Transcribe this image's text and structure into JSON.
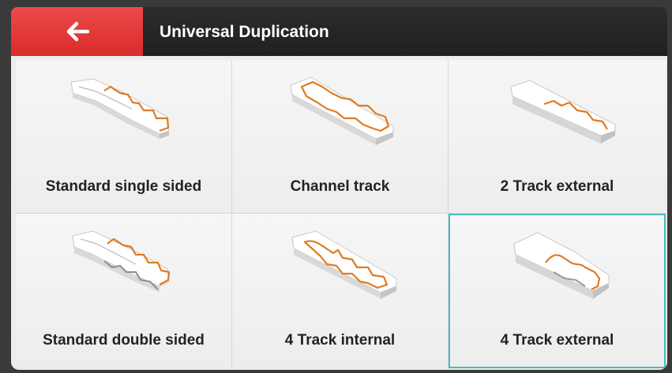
{
  "header": {
    "title": "Universal Duplication",
    "back_icon": "arrow-left-icon",
    "back_color": "#e53a3a"
  },
  "options": [
    {
      "label": "Standard single sided",
      "icon": "key-standard-single-sided-icon"
    },
    {
      "label": "Channel track",
      "icon": "key-channel-track-icon"
    },
    {
      "label": "2 Track external",
      "icon": "key-2-track-external-icon"
    },
    {
      "label": "Standard double sided",
      "icon": "key-standard-double-sided-icon"
    },
    {
      "label": "4 Track internal",
      "icon": "key-4-track-internal-icon"
    },
    {
      "label": "4 Track external",
      "icon": "key-4-track-external-icon"
    }
  ],
  "selected_option": "4 Track external",
  "colors": {
    "accent": "#4bb9c4",
    "cut_line": "#e07a1f"
  }
}
